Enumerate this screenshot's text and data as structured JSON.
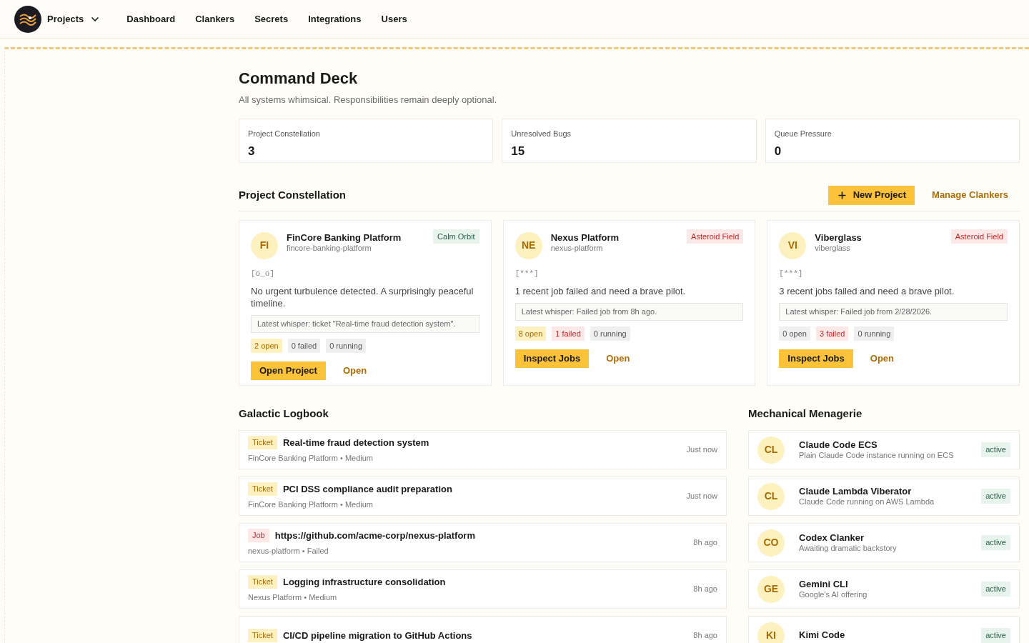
{
  "nav": {
    "brand": "Projects",
    "links": [
      "Dashboard",
      "Clankers",
      "Secrets",
      "Integrations",
      "Users"
    ]
  },
  "header": {
    "title": "Command Deck",
    "subtitle": "All systems whimsical. Responsibilities remain deeply optional."
  },
  "stats": [
    {
      "label": "Project Constellation",
      "value": "3"
    },
    {
      "label": "Unresolved Bugs",
      "value": "15"
    },
    {
      "label": "Queue Pressure",
      "value": "0"
    }
  ],
  "projects_section": {
    "title": "Project Constellation",
    "new_button": "New Project",
    "manage_link": "Manage Clankers"
  },
  "projects": [
    {
      "initials": "FI",
      "name": "FinCore Banking Platform",
      "slug": "fincore-banking-platform",
      "status": {
        "kind": "calm",
        "label": "Calm Orbit"
      },
      "face": "[o_o]",
      "message": "No urgent turbulence detected. A surprisingly peaceful timeline.",
      "whisper": "Latest whisper: ticket \"Real-time fraud detection system\".",
      "chips": [
        {
          "kind": "open",
          "label": "2 open"
        },
        {
          "kind": "idle",
          "label": "0 failed"
        },
        {
          "kind": "idle",
          "label": "0 running"
        }
      ],
      "primary": "Open Project",
      "secondary": "Open"
    },
    {
      "initials": "NE",
      "name": "Nexus Platform",
      "slug": "nexus-platform",
      "status": {
        "kind": "alert",
        "label": "Asteroid Field"
      },
      "face": "[***]",
      "message": "1 recent job failed and need a brave pilot.",
      "whisper": "Latest whisper: Failed job from 8h ago.",
      "chips": [
        {
          "kind": "open",
          "label": "8 open"
        },
        {
          "kind": "failed",
          "label": "1 failed"
        },
        {
          "kind": "idle",
          "label": "0 running"
        }
      ],
      "primary": "Inspect Jobs",
      "secondary": "Open"
    },
    {
      "initials": "VI",
      "name": "Viberglass",
      "slug": "viberglass",
      "status": {
        "kind": "alert",
        "label": "Asteroid Field"
      },
      "face": "[***]",
      "message": "3 recent jobs failed and need a brave pilot.",
      "whisper": "Latest whisper: Failed job from 2/28/2026.",
      "chips": [
        {
          "kind": "idle",
          "label": "0 open"
        },
        {
          "kind": "failed",
          "label": "3 failed"
        },
        {
          "kind": "idle",
          "label": "0 running"
        }
      ],
      "primary": "Inspect Jobs",
      "secondary": "Open"
    }
  ],
  "logbook": {
    "title": "Galactic Logbook",
    "entries": [
      {
        "kind": "ticket",
        "tag": "Ticket",
        "title": "Real-time fraud detection system",
        "meta": "FinCore Banking Platform • Medium",
        "time": "Just now"
      },
      {
        "kind": "ticket",
        "tag": "Ticket",
        "title": "PCI DSS compliance audit preparation",
        "meta": "FinCore Banking Platform • Medium",
        "time": "Just now"
      },
      {
        "kind": "job",
        "tag": "Job",
        "title": "https://github.com/acme-corp/nexus-platform",
        "meta": "nexus-platform • Failed",
        "time": "8h ago"
      },
      {
        "kind": "ticket",
        "tag": "Ticket",
        "title": "Logging infrastructure consolidation",
        "meta": "Nexus Platform • Medium",
        "time": "8h ago"
      },
      {
        "kind": "ticket",
        "tag": "Ticket",
        "title": "CI/CD pipeline migration to GitHub Actions",
        "time": "8h ago"
      }
    ]
  },
  "menagerie": {
    "title": "Mechanical Menagerie",
    "agents": [
      {
        "initials": "CL",
        "name": "Claude Code ECS",
        "description": "Plain Claude Code instance running on ECS",
        "status": "active"
      },
      {
        "initials": "CL",
        "name": "Claude Lambda Viberator",
        "description": "Claude Code running on AWS Lambda",
        "status": "active"
      },
      {
        "initials": "CO",
        "name": "Codex Clanker",
        "description": "Awaiting dramatic backstory",
        "status": "active"
      },
      {
        "initials": "GE",
        "name": "Gemini CLI",
        "description": "Google's AI offering",
        "status": "active"
      },
      {
        "initials": "KI",
        "name": "Kimi Code",
        "status": "active"
      }
    ]
  }
}
